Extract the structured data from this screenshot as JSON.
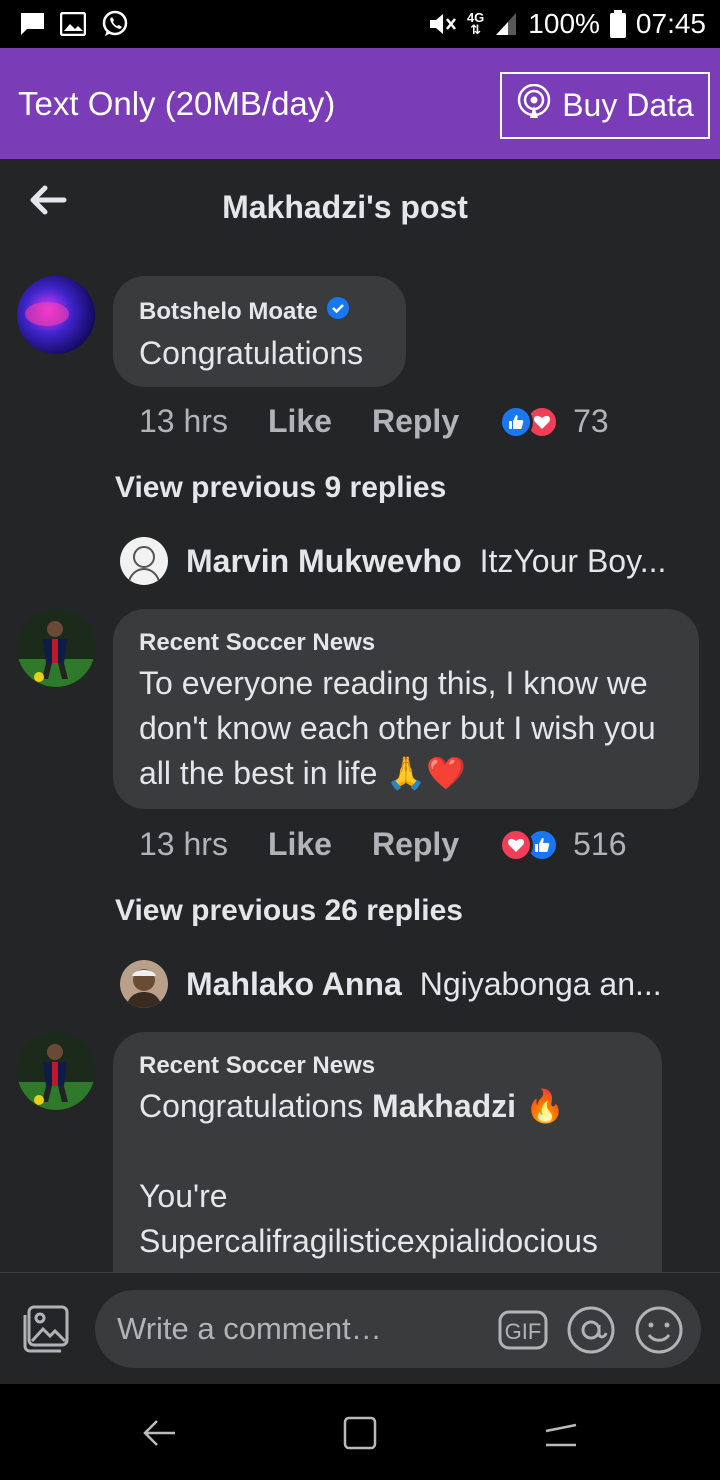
{
  "status_bar": {
    "battery": "100%",
    "time": "07:45",
    "network": "4G"
  },
  "banner": {
    "plan": "Text Only (20MB/day)",
    "buy_label": "Buy Data"
  },
  "header": {
    "title": "Makhadzi's post"
  },
  "comments": [
    {
      "author": "Botshelo Moate",
      "verified": true,
      "text": "Congratulations",
      "time": "13 hrs",
      "like_label": "Like",
      "reply_label": "Reply",
      "reaction_count": "73",
      "view_previous": "View previous 9 replies",
      "latest_reply": {
        "name": "Marvin Mukwevho",
        "text": "ItzYour Boy..."
      }
    },
    {
      "author": "Recent Soccer News",
      "text": "To everyone reading this, I know we don't know each other but I wish you all the best in life 🙏❤️",
      "time": "13 hrs",
      "like_label": "Like",
      "reply_label": "Reply",
      "reaction_count": "516",
      "view_previous": "View previous 26 replies",
      "latest_reply": {
        "name": "Mahlako Anna",
        "text": "Ngiyabonga an..."
      }
    },
    {
      "author": "Recent Soccer News",
      "text_prefix": "Congratulations ",
      "text_bold": "Makhadzi",
      "text_emoji": "🔥",
      "text_line2": "You're Supercalifragilisticexpialidocious"
    }
  ],
  "composer": {
    "placeholder": "Write a comment…",
    "gif_label": "GIF"
  },
  "colors": {
    "banner": "#7b3cb8",
    "background": "#242526",
    "bubble": "#3a3b3c",
    "like_blue": "#1877f2",
    "love_red": "#f33e58"
  }
}
